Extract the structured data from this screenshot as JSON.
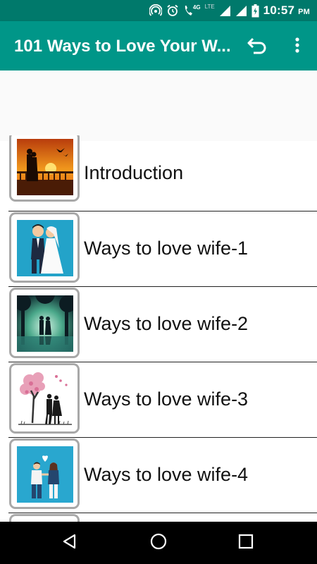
{
  "status_bar": {
    "time": "10:57",
    "ampm": "PM",
    "network_label": "4G",
    "lte_label": "LTE",
    "icons": [
      "hotspot-icon",
      "alarm-icon",
      "wifi-calling-icon",
      "signal-icon",
      "signal-icon",
      "battery-charging-icon"
    ]
  },
  "app_bar": {
    "title": "101 Ways to Love Your W...",
    "icons": [
      "undo-icon",
      "more-vert-icon"
    ],
    "color": "#009688"
  },
  "list": {
    "items": [
      {
        "label": "Introduction",
        "icon": "couple-sunset-thumbnail"
      },
      {
        "label": "Ways to love wife-1",
        "icon": "wedding-couple-thumbnail"
      },
      {
        "label": "Ways to love wife-2",
        "icon": "couple-forest-thumbnail"
      },
      {
        "label": "Ways to love wife-3",
        "icon": "couple-heart-tree-thumbnail"
      },
      {
        "label": "Ways to love wife-4",
        "icon": "couple-holding-hands-thumbnail"
      }
    ]
  },
  "nav_bar": {
    "icons": [
      "back-icon",
      "home-icon",
      "recents-icon"
    ]
  }
}
